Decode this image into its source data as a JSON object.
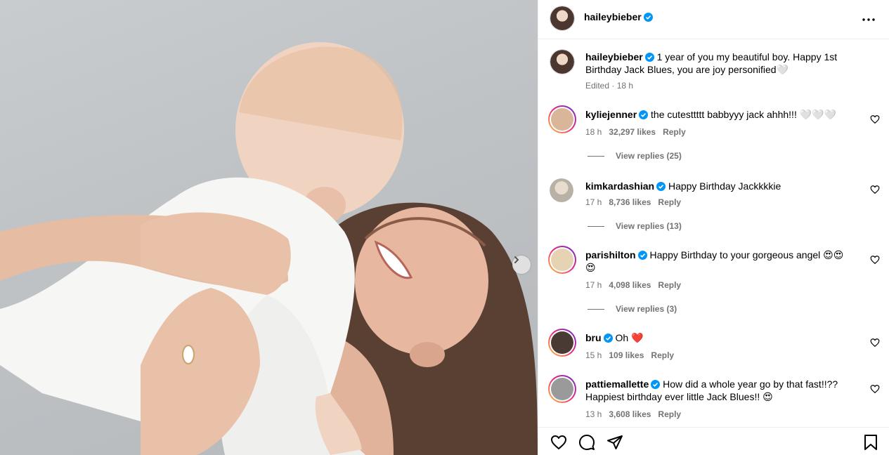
{
  "post": {
    "author": "haileybieber",
    "caption": "1 year of you my beautiful boy. Happy 1st Birthday Jack Blues, you are joy personified🤍",
    "caption_meta": "Edited · 18 h"
  },
  "comments": [
    {
      "user": "kyliejenner",
      "text": "the cutesttttt babbyyy jack ahhh!!! 🤍🤍🤍",
      "time": "18 h",
      "likes": "32,297 likes",
      "reply": "Reply",
      "view_replies": "View replies (25)",
      "avatar_color": "#d9b59a"
    },
    {
      "user": "kimkardashian",
      "text": "Happy Birthday Jackkkkie",
      "time": "17 h",
      "likes": "8,736 likes",
      "reply": "Reply",
      "view_replies": "View replies (13)",
      "avatar_color": "#c8c2b8"
    },
    {
      "user": "parishilton",
      "text": "Happy Birthday to your gorgeous angel 😍😍😍",
      "time": "17 h",
      "likes": "4,098 likes",
      "reply": "Reply",
      "view_replies": "View replies (3)",
      "avatar_color": "#e6d3b4"
    },
    {
      "user": "bru",
      "text": "Oh ❤️",
      "time": "15 h",
      "likes": "109 likes",
      "reply": "Reply",
      "avatar_color": "#4a3a34"
    },
    {
      "user": "pattiemallette",
      "text": "How did a whole year go by that fast!!?? Happiest birthday ever little Jack Blues!! 😍",
      "time": "13 h",
      "likes": "3,608 likes",
      "reply": "Reply",
      "avatar_color": "#9a9a9a"
    }
  ],
  "icons": {
    "verified": "verified-badge-icon",
    "more": "more-options-icon",
    "like": "heart-icon",
    "comment": "comment-icon",
    "share": "share-icon",
    "save": "bookmark-icon",
    "next": "chevron-right-icon"
  },
  "colors": {
    "verified": "#0095f6",
    "muted": "#737373",
    "divider": "#efefef"
  }
}
